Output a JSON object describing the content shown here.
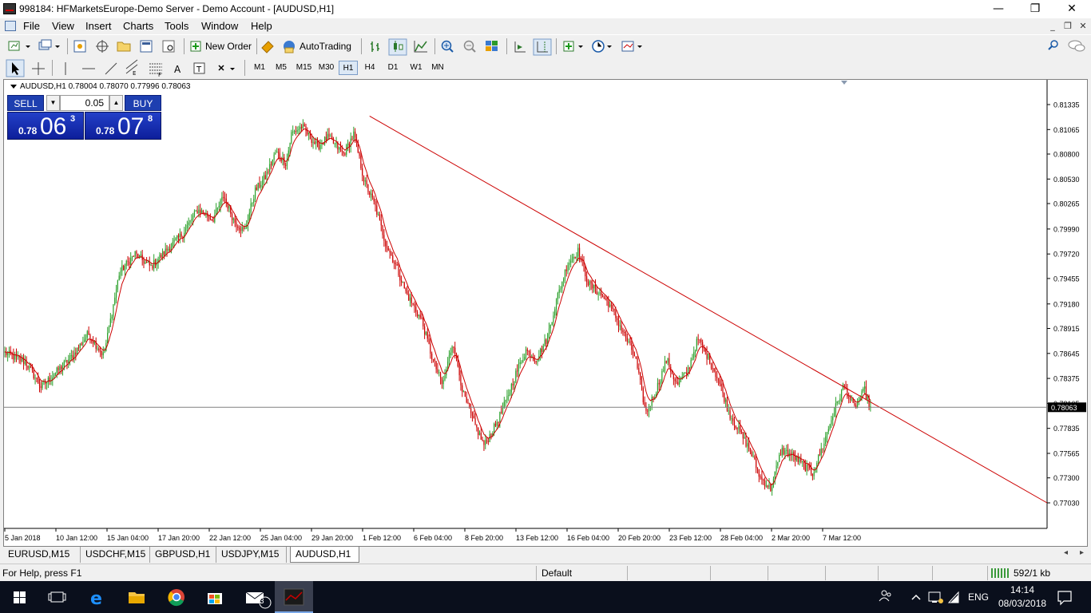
{
  "window": {
    "title": "998184: HFMarketsEurope-Demo Server - Demo Account - [AUDUSD,H1]",
    "minimize": "—",
    "restore": "❐",
    "close": "✕"
  },
  "menu": {
    "items": [
      "File",
      "View",
      "Insert",
      "Charts",
      "Tools",
      "Window",
      "Help"
    ],
    "mdi_min": "_",
    "mdi_restore": "❐",
    "mdi_close": "✕"
  },
  "toolbar": {
    "new_order": "New Order",
    "auto_trading": "AutoTrading",
    "timeframes": [
      "M1",
      "M5",
      "M15",
      "M30",
      "H1",
      "H4",
      "D1",
      "W1",
      "MN"
    ],
    "active_timeframe": "H1"
  },
  "chart": {
    "header": "AUDUSD,H1  0.78004 0.78070 0.77996 0.78063",
    "current_price_label": "0.78063",
    "one_click": {
      "sell": "SELL",
      "buy": "BUY",
      "lot": "0.05",
      "down_arrow": "▼",
      "up_arrow": "▲",
      "sell_prefix": "0.78",
      "sell_big": "06",
      "sell_sup": "3",
      "buy_prefix": "0.78",
      "buy_big": "07",
      "buy_sup": "8"
    }
  },
  "chart_data": {
    "type": "candlestick",
    "symbol": "AUDUSD",
    "timeframe": "H1",
    "y_ticks": [
      "0.81335",
      "0.81065",
      "0.80800",
      "0.80530",
      "0.80265",
      "0.79990",
      "0.79720",
      "0.79455",
      "0.79180",
      "0.78915",
      "0.78645",
      "0.78375",
      "0.78105",
      "0.77835",
      "0.77565",
      "0.77300",
      "0.77030"
    ],
    "ylim": [
      0.7703,
      0.81335
    ],
    "x_ticks": [
      "5 Jan 2018",
      "10 Jan 12:00",
      "15 Jan 04:00",
      "17 Jan 20:00",
      "22 Jan 12:00",
      "25 Jan 04:00",
      "29 Jan 20:00",
      "1 Feb 12:00",
      "6 Feb 04:00",
      "8 Feb 20:00",
      "13 Feb 12:00",
      "16 Feb 04:00",
      "20 Feb 20:00",
      "23 Feb 12:00",
      "28 Feb 04:00",
      "2 Mar 20:00",
      "7 Mar 12:00"
    ],
    "price_path": [
      [
        0,
        0.7865
      ],
      [
        4,
        0.7855
      ],
      [
        7,
        0.7828
      ],
      [
        10,
        0.7845
      ],
      [
        13,
        0.7862
      ],
      [
        16,
        0.7886
      ],
      [
        19,
        0.7862
      ],
      [
        22,
        0.7952
      ],
      [
        25,
        0.7972
      ],
      [
        28,
        0.7958
      ],
      [
        31,
        0.7976
      ],
      [
        34,
        0.7993
      ],
      [
        37,
        0.802
      ],
      [
        40,
        0.801
      ],
      [
        42,
        0.8035
      ],
      [
        44,
        0.8008
      ],
      [
        46,
        0.7996
      ],
      [
        48,
        0.804
      ],
      [
        50,
        0.8055
      ],
      [
        52,
        0.8082
      ],
      [
        54,
        0.807
      ],
      [
        55,
        0.8102
      ],
      [
        57,
        0.811
      ],
      [
        60,
        0.8088
      ],
      [
        62,
        0.8098
      ],
      [
        65,
        0.808
      ],
      [
        67,
        0.8102
      ],
      [
        69,
        0.805
      ],
      [
        71,
        0.8025
      ],
      [
        73,
        0.7985
      ],
      [
        75,
        0.796
      ],
      [
        77,
        0.793
      ],
      [
        80,
        0.79
      ],
      [
        82,
        0.786
      ],
      [
        84,
        0.783
      ],
      [
        86,
        0.7878
      ],
      [
        88,
        0.782
      ],
      [
        90,
        0.779
      ],
      [
        92,
        0.7765
      ],
      [
        94,
        0.7785
      ],
      [
        96,
        0.781
      ],
      [
        98,
        0.7842
      ],
      [
        100,
        0.7868
      ],
      [
        102,
        0.7858
      ],
      [
        104,
        0.788
      ],
      [
        106,
        0.7925
      ],
      [
        108,
        0.7962
      ],
      [
        110,
        0.7975
      ],
      [
        112,
        0.794
      ],
      [
        114,
        0.793
      ],
      [
        116,
        0.7918
      ],
      [
        118,
        0.7895
      ],
      [
        121,
        0.786
      ],
      [
        123,
        0.78
      ],
      [
        125,
        0.7825
      ],
      [
        127,
        0.7858
      ],
      [
        129,
        0.783
      ],
      [
        131,
        0.7845
      ],
      [
        133,
        0.788
      ],
      [
        135,
        0.786
      ],
      [
        137,
        0.7835
      ],
      [
        139,
        0.78
      ],
      [
        141,
        0.778
      ],
      [
        143,
        0.776
      ],
      [
        145,
        0.773
      ],
      [
        147,
        0.7718
      ],
      [
        149,
        0.776
      ],
      [
        151,
        0.7755
      ],
      [
        153,
        0.7745
      ],
      [
        155,
        0.7735
      ],
      [
        157,
        0.7765
      ],
      [
        159,
        0.78
      ],
      [
        161,
        0.783
      ],
      [
        163,
        0.7805
      ],
      [
        165,
        0.7825
      ],
      [
        166,
        0.7806
      ]
    ],
    "trendline": {
      "from": [
        70,
        0.8121
      ],
      "to": [
        200,
        0.7703
      ],
      "color": "#cc0000"
    },
    "current_price": 0.78063
  },
  "tabs": [
    "EURUSD,M15",
    "USDCHF,M15",
    "GBPUSD,H1",
    "USDJPY,M15",
    "AUDUSD,H1"
  ],
  "active_tab": "AUDUSD,H1",
  "status": {
    "help": "For Help, press F1",
    "profile": "Default",
    "traffic": "592/1 kb"
  },
  "taskbar": {
    "time": "14:14",
    "date": "08/03/2018",
    "lang": "ENG",
    "mail_badge": "3"
  }
}
